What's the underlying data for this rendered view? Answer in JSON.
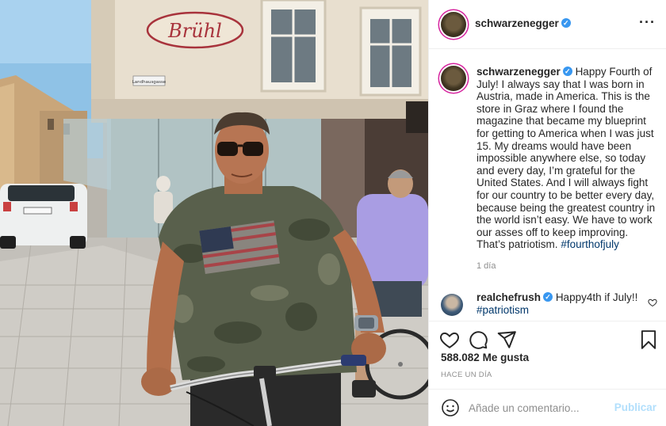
{
  "post": {
    "author": "schwarzenegger",
    "verified_mark": "✓",
    "more_label": "···",
    "image_sign_text": "Brühl",
    "image_street_sign": "Landhausgasse"
  },
  "caption": {
    "username": "schwarzenegger",
    "text": "Happy Fourth of July! I always say that I was born in Austria, made in America. This is the store in Graz where I found the magazine that became my blueprint for getting to America when I was just 15. My dreams would have been impossible anywhere else, so today and every day, I’m grateful for the United States. And I will always fight for our country to be better every day, because being the greatest country in the world isn’t easy. We have to work our asses off to keep improving. That’s patriotism.",
    "hashtag": "#fourthofjuly",
    "age": "1 día"
  },
  "comment": {
    "username": "realchefrush",
    "text": "Happy4th if July!!",
    "hashtag": "#patriotism"
  },
  "actions": {
    "likes_count": "588.082",
    "likes_suffix": "Me gusta",
    "posted_label": "HACE UN DÍA"
  },
  "composer": {
    "placeholder": "Añade un comentario...",
    "publish_label": "Publicar"
  },
  "icons": {
    "like": "heart-icon",
    "comment": "comment-bubble-icon",
    "share": "paper-plane-icon",
    "save": "bookmark-icon",
    "emoji": "smiley-icon",
    "more": "ellipsis-icon",
    "verified": "verified-badge-icon"
  },
  "colors": {
    "verified": "#3897f0",
    "hashtag": "#00376b",
    "muted": "#8e8e8e",
    "publish_disabled": "#b2dffc",
    "text": "#262626"
  }
}
